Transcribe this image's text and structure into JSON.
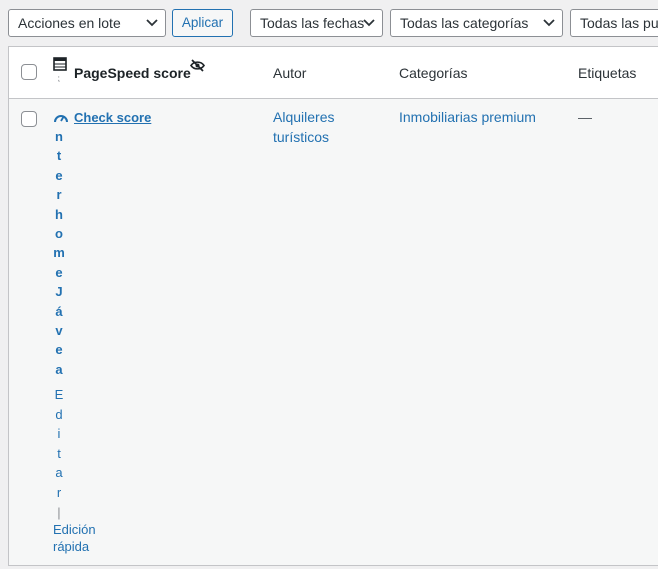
{
  "toolbar": {
    "bulk_actions": "Acciones en lote",
    "apply": "Aplicar",
    "dates": "Todas las fechas",
    "categories": "Todas las categorías",
    "third": "Todas las pu"
  },
  "table": {
    "headers": {
      "pagespeed": "PageSpeed score",
      "author": "Autor",
      "categories": "Categorías",
      "tags": "Etiquetas"
    },
    "row": {
      "check_score": "Check score",
      "title_letters": [
        "n",
        "t",
        "e",
        "r",
        "h",
        "o",
        "m",
        "e",
        "J",
        "á",
        "v",
        "e",
        "a"
      ],
      "edit_letters": [
        "E",
        "d",
        "i",
        "t",
        "a",
        "r",
        "|"
      ],
      "quick_edit": [
        "Edición",
        "rápida"
      ],
      "author": [
        "Alquileres",
        "turísticos"
      ],
      "category": "Inmobiliarias premium",
      "tags": "—"
    }
  },
  "colors": {
    "link": "#2271b1",
    "border": "#c3c4c7",
    "background": "#f0f0f1"
  }
}
